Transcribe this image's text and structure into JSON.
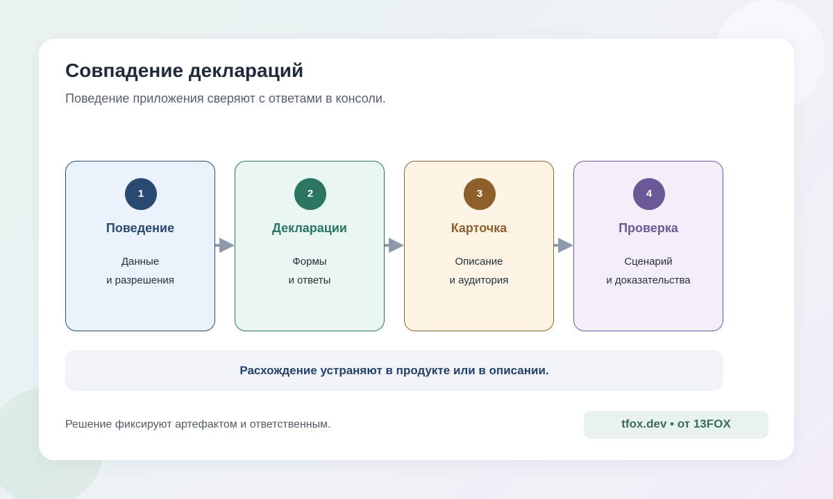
{
  "header": {
    "title": "Совпадение деклараций",
    "subtitle": "Поведение приложения сверяют с ответами в консоли."
  },
  "steps": [
    {
      "number": "1",
      "name": "Поведение",
      "line1": "Данные",
      "line2": "и разрешения",
      "color": "#2b4a72"
    },
    {
      "number": "2",
      "name": "Декларации",
      "line1": "Формы",
      "line2": "и ответы",
      "color": "#2b7561"
    },
    {
      "number": "3",
      "name": "Карточка",
      "line1": "Описание",
      "line2": "и аудитория",
      "color": "#8d5f2a"
    },
    {
      "number": "4",
      "name": "Проверка",
      "line1": "Сценарий",
      "line2": "и доказательства",
      "color": "#6b5896"
    }
  ],
  "note": "Расхождение устраняют в продукте или в описании.",
  "footer": {
    "text": "Решение фиксируют артефактом и ответственным.",
    "brand": "tfox.dev • от 13FOX"
  },
  "colors": {
    "arrow": "#8d9aab",
    "accent": "#24406a"
  }
}
